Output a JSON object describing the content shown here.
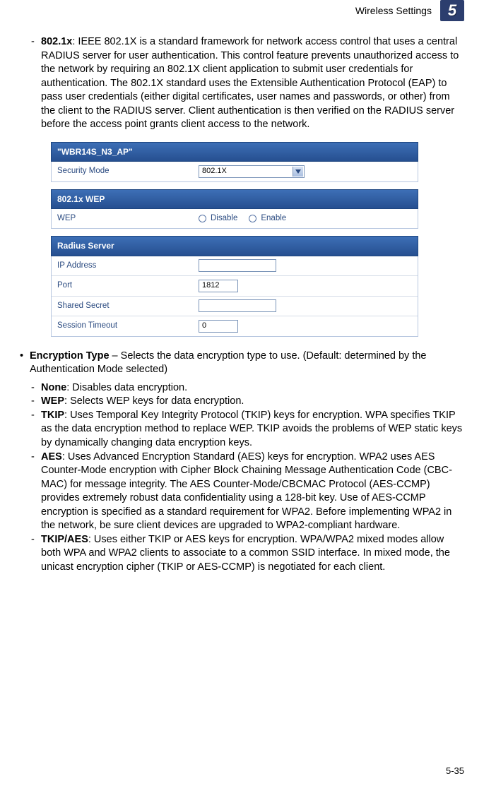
{
  "header": {
    "title": "Wireless Settings",
    "chapter": "5"
  },
  "section1": {
    "term": "802.1x",
    "text": ": IEEE 802.1X is a standard framework for network access control that uses a central RADIUS server for user authentication. This control feature prevents unauthorized access to the network by requiring an 802.1X client application to submit user credentials for authentication. The 802.1X standard uses the Extensible Authentication Protocol (EAP) to pass user credentials (either digital certificates, user names and passwords, or other) from the client to the RADIUS server. Client authentication is then verified on the RADIUS server before the access point grants client access to the network."
  },
  "ui": {
    "panel1_title": "\"WBR14S_N3_AP\"",
    "security_mode_label": "Security Mode",
    "security_mode_value": "802.1X",
    "panel2_title": "802.1x WEP",
    "wep_label": "WEP",
    "disable_label": "Disable",
    "enable_label": "Enable",
    "panel3_title": "Radius Server",
    "ip_label": "IP Address",
    "ip_value": "",
    "port_label": "Port",
    "port_value": "1812",
    "secret_label": "Shared Secret",
    "secret_value": "",
    "timeout_label": "Session Timeout",
    "timeout_value": "0"
  },
  "section2": {
    "bullet_term": "Encryption Type",
    "bullet_text": " – Selects the data encryption type to use. (Default: determined by the Authentication Mode selected)",
    "items": {
      "none_term": "None",
      "none_text": ": Disables data encryption.",
      "wep_term": "WEP",
      "wep_text": ": Selects WEP keys for data encryption.",
      "tkip_term": "TKIP",
      "tkip_text": ": Uses Temporal Key Integrity Protocol (TKIP) keys for encryption. WPA specifies TKIP as the data encryption method to replace WEP. TKIP avoids the problems of WEP static keys by dynamically changing data encryption keys.",
      "aes_term": "AES",
      "aes_text": ": Uses Advanced Encryption Standard (AES) keys for encryption. WPA2 uses AES Counter-Mode encryption with Cipher Block Chaining Message Authentication Code (CBC-MAC) for message integrity. The AES Counter-Mode/CBCMAC Protocol (AES-CCMP) provides extremely robust data confidentiality using a 128-bit key. Use of AES-CCMP encryption is specified as a standard requirement for WPA2. Before implementing WPA2 in the network, be sure client devices are upgraded to WPA2-compliant hardware.",
      "tkipaes_term": "TKIP/AES",
      "tkipaes_text": ": Uses either TKIP or AES keys for encryption. WPA/WPA2 mixed modes allow both WPA and WPA2 clients to associate to a common SSID interface. In mixed mode, the unicast encryption cipher (TKIP or AES-CCMP) is negotiated for each client."
    }
  },
  "footer": {
    "page": "5-35"
  }
}
